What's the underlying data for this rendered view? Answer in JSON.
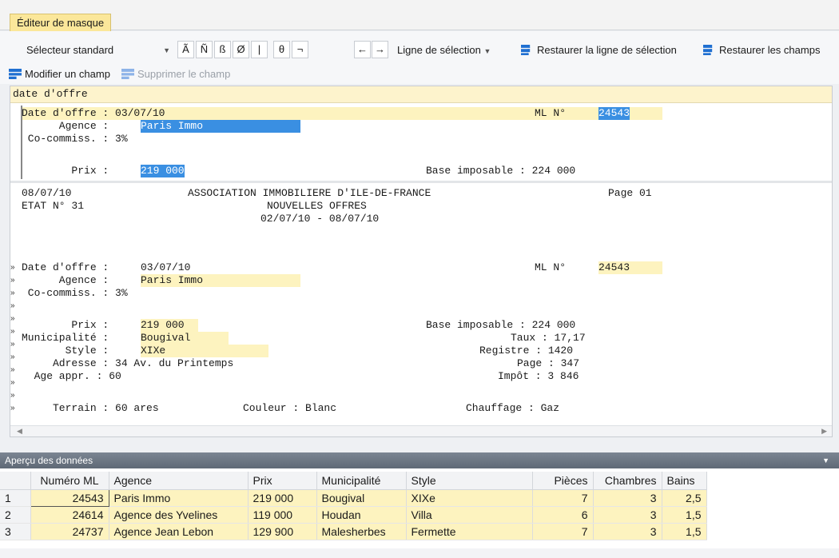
{
  "tab": {
    "label": "Éditeur de masque"
  },
  "toolbar": {
    "selector": "Sélecteur standard",
    "chars": [
      "Ã",
      "Ñ",
      "ß",
      "Ø",
      "|",
      "θ",
      "¬"
    ],
    "arrows": [
      "←",
      "→"
    ],
    "selection_line": "Ligne de sélection",
    "restore_line": "Restaurer la ligne de sélection",
    "restore_fields": "Restaurer les champs",
    "modify_field": "Modifier un champ",
    "delete_field": "Supprimer le champ"
  },
  "editor": {
    "field_name": "date d'offre",
    "top": {
      "l1a": "Date d'offre : 03/07/10",
      "l1b": "ML N°",
      "l1c": "24543",
      "l2a": "      Agence : ",
      "l2b": "Paris Immo",
      "l3": " Co-commiss. : 3%",
      "l5a": "        Prix : ",
      "l5b": "219 000",
      "l5c": "Base imposable : 224 000"
    },
    "report": {
      "date": "08/07/10",
      "assoc": "ASSOCIATION IMMOBILIERE D'ILE-DE-FRANCE",
      "page": "Page 01",
      "etat": "ETAT N° 31",
      "title": "NOUVELLES OFFRES",
      "range": "02/07/10 - 08/07/10",
      "r1a": "Date d'offre : ",
      "r1b": "03/07/10",
      "r1c": "ML N°",
      "r1d": "24543",
      "r2a": "      Agence : ",
      "r2b": "Paris Immo",
      "r3": " Co-commiss. : 3%",
      "r5a": "        Prix : ",
      "r5b": "219 000",
      "r5c": "Base imposable : 224 000",
      "r6a": "Municipalité : ",
      "r6b": "Bougival",
      "r6c": "Taux : 17,17",
      "r7a": "       Style : ",
      "r7b": "XIXe",
      "r7c": "Registre : 1420",
      "r8a": "     Adresse : 34 Av. du Printemps",
      "r8c": "Page : 347",
      "r9a": "  Age appr. : 60",
      "r9c": "Impôt : 3 846",
      "r11a": "     Terrain : 60 ares",
      "r11b": "Couleur : Blanc",
      "r11c": "Chauffage : Gaz"
    },
    "gutter_mark": "»"
  },
  "preview": {
    "title": "Aperçu des données",
    "columns": [
      "Numéro ML",
      "Agence",
      "Prix",
      "Municipalité",
      "Style",
      "Pièces",
      "Chambres",
      "Bains"
    ],
    "rows": [
      {
        "n": "1",
        "ml": "24543",
        "agence": "Paris Immo",
        "prix": "219 000",
        "muni": "Bougival",
        "style": "XIXe",
        "pieces": "7",
        "chambres": "3",
        "bains": "2,5"
      },
      {
        "n": "2",
        "ml": "24614",
        "agence": "Agence des Yvelines",
        "prix": "119 000",
        "muni": "Houdan",
        "style": "Villa",
        "pieces": "6",
        "chambres": "3",
        "bains": "1,5"
      },
      {
        "n": "3",
        "ml": "24737",
        "agence": "Agence Jean Lebon",
        "prix": "129 900",
        "muni": "Malesherbes",
        "style": "Fermette",
        "pieces": "7",
        "chambres": "3",
        "bains": "1,5"
      }
    ]
  }
}
